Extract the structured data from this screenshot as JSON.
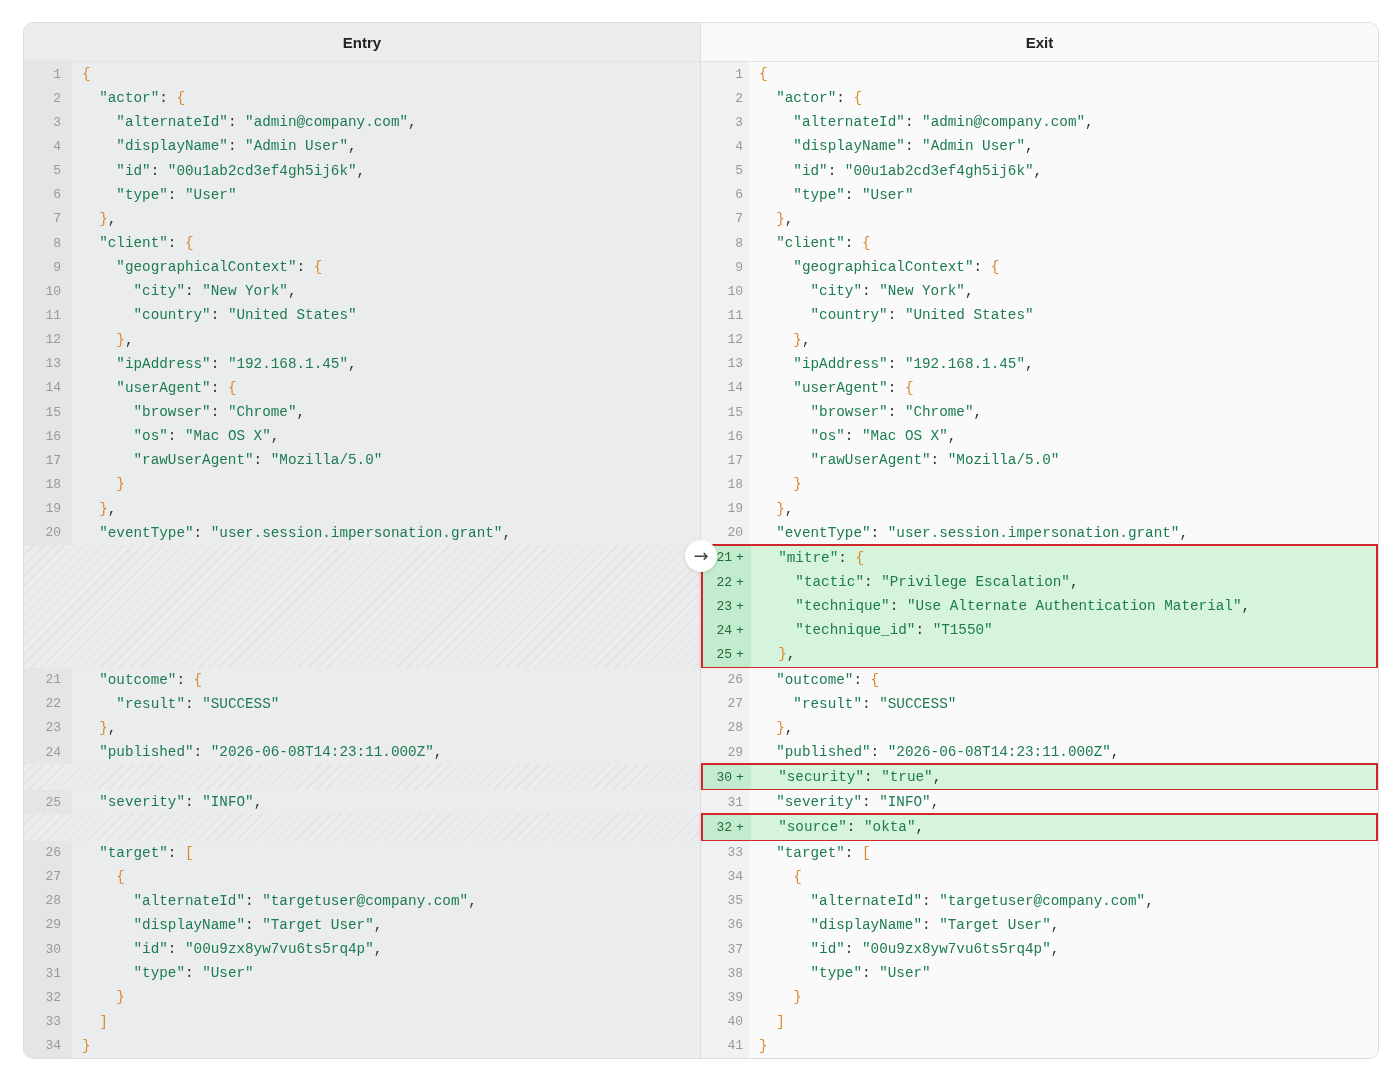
{
  "panes": [
    {
      "title": "Entry"
    },
    {
      "title": "Exit"
    }
  ],
  "blocks": [
    {
      "kind": "same",
      "rows": [
        {
          "left": {
            "number": "1",
            "code": "{"
          },
          "right": {
            "number": "1",
            "code": "{"
          }
        },
        {
          "left": {
            "number": "2",
            "code": "  \"actor\": {"
          },
          "right": {
            "number": "2",
            "code": "  \"actor\": {"
          }
        },
        {
          "left": {
            "number": "3",
            "code": "    \"alternateId\": \"admin@company.com\","
          },
          "right": {
            "number": "3",
            "code": "    \"alternateId\": \"admin@company.com\","
          }
        },
        {
          "left": {
            "number": "4",
            "code": "    \"displayName\": \"Admin User\","
          },
          "right": {
            "number": "4",
            "code": "    \"displayName\": \"Admin User\","
          }
        },
        {
          "left": {
            "number": "5",
            "code": "    \"id\": \"00u1ab2cd3ef4gh5ij6k\","
          },
          "right": {
            "number": "5",
            "code": "    \"id\": \"00u1ab2cd3ef4gh5ij6k\","
          }
        },
        {
          "left": {
            "number": "6",
            "code": "    \"type\": \"User\""
          },
          "right": {
            "number": "6",
            "code": "    \"type\": \"User\""
          }
        },
        {
          "left": {
            "number": "7",
            "code": "  },"
          },
          "right": {
            "number": "7",
            "code": "  },"
          }
        },
        {
          "left": {
            "number": "8",
            "code": "  \"client\": {"
          },
          "right": {
            "number": "8",
            "code": "  \"client\": {"
          }
        },
        {
          "left": {
            "number": "9",
            "code": "    \"geographicalContext\": {"
          },
          "right": {
            "number": "9",
            "code": "    \"geographicalContext\": {"
          }
        },
        {
          "left": {
            "number": "10",
            "code": "      \"city\": \"New York\","
          },
          "right": {
            "number": "10",
            "code": "      \"city\": \"New York\","
          }
        },
        {
          "left": {
            "number": "11",
            "code": "      \"country\": \"United States\""
          },
          "right": {
            "number": "11",
            "code": "      \"country\": \"United States\""
          }
        },
        {
          "left": {
            "number": "12",
            "code": "    },"
          },
          "right": {
            "number": "12",
            "code": "    },"
          }
        },
        {
          "left": {
            "number": "13",
            "code": "    \"ipAddress\": \"192.168.1.45\","
          },
          "right": {
            "number": "13",
            "code": "    \"ipAddress\": \"192.168.1.45\","
          }
        },
        {
          "left": {
            "number": "14",
            "code": "    \"userAgent\": {"
          },
          "right": {
            "number": "14",
            "code": "    \"userAgent\": {"
          }
        },
        {
          "left": {
            "number": "15",
            "code": "      \"browser\": \"Chrome\","
          },
          "right": {
            "number": "15",
            "code": "      \"browser\": \"Chrome\","
          }
        },
        {
          "left": {
            "number": "16",
            "code": "      \"os\": \"Mac OS X\","
          },
          "right": {
            "number": "16",
            "code": "      \"os\": \"Mac OS X\","
          }
        },
        {
          "left": {
            "number": "17",
            "code": "      \"rawUserAgent\": \"Mozilla/5.0\""
          },
          "right": {
            "number": "17",
            "code": "      \"rawUserAgent\": \"Mozilla/5.0\""
          }
        },
        {
          "left": {
            "number": "18",
            "code": "    }"
          },
          "right": {
            "number": "18",
            "code": "    }"
          }
        },
        {
          "left": {
            "number": "19",
            "code": "  },"
          },
          "right": {
            "number": "19",
            "code": "  },"
          }
        },
        {
          "left": {
            "number": "20",
            "code": "  \"eventType\": \"user.session.impersonation.grant\","
          },
          "right": {
            "number": "20",
            "code": "  \"eventType\": \"user.session.impersonation.grant\","
          }
        }
      ]
    },
    {
      "kind": "added",
      "action": "→",
      "lines": [
        {
          "number": "21",
          "marker": "+",
          "code": "  \"mitre\": {"
        },
        {
          "number": "22",
          "marker": "+",
          "code": "    \"tactic\": \"Privilege Escalation\","
        },
        {
          "number": "23",
          "marker": "+",
          "code": "    \"technique\": \"Use Alternate Authentication Material\","
        },
        {
          "number": "24",
          "marker": "+",
          "code": "    \"technique_id\": \"T1550\""
        },
        {
          "number": "25",
          "marker": "+",
          "code": "  },"
        }
      ]
    },
    {
      "kind": "same",
      "rows": [
        {
          "left": {
            "number": "21",
            "code": "  \"outcome\": {"
          },
          "right": {
            "number": "26",
            "code": "  \"outcome\": {"
          }
        },
        {
          "left": {
            "number": "22",
            "code": "    \"result\": \"SUCCESS\""
          },
          "right": {
            "number": "27",
            "code": "    \"result\": \"SUCCESS\""
          }
        },
        {
          "left": {
            "number": "23",
            "code": "  },"
          },
          "right": {
            "number": "28",
            "code": "  },"
          }
        },
        {
          "left": {
            "number": "24",
            "code": "  \"published\": \"2026-06-08T14:23:11.000Z\","
          },
          "right": {
            "number": "29",
            "code": "  \"published\": \"2026-06-08T14:23:11.000Z\","
          }
        }
      ]
    },
    {
      "kind": "added",
      "lines": [
        {
          "number": "30",
          "marker": "+",
          "code": "  \"security\": \"true\","
        }
      ]
    },
    {
      "kind": "same",
      "rows": [
        {
          "left": {
            "number": "25",
            "code": "  \"severity\": \"INFO\","
          },
          "right": {
            "number": "31",
            "code": "  \"severity\": \"INFO\","
          }
        }
      ]
    },
    {
      "kind": "added",
      "lines": [
        {
          "number": "32",
          "marker": "+",
          "code": "  \"source\": \"okta\","
        }
      ]
    },
    {
      "kind": "same",
      "rows": [
        {
          "left": {
            "number": "26",
            "code": "  \"target\": ["
          },
          "right": {
            "number": "33",
            "code": "  \"target\": ["
          }
        },
        {
          "left": {
            "number": "27",
            "code": "    {"
          },
          "right": {
            "number": "34",
            "code": "    {"
          }
        },
        {
          "left": {
            "number": "28",
            "code": "      \"alternateId\": \"targetuser@company.com\","
          },
          "right": {
            "number": "35",
            "code": "      \"alternateId\": \"targetuser@company.com\","
          }
        },
        {
          "left": {
            "number": "29",
            "code": "      \"displayName\": \"Target User\","
          },
          "right": {
            "number": "36",
            "code": "      \"displayName\": \"Target User\","
          }
        },
        {
          "left": {
            "number": "30",
            "code": "      \"id\": \"00u9zx8yw7vu6ts5rq4p\","
          },
          "right": {
            "number": "37",
            "code": "      \"id\": \"00u9zx8yw7vu6ts5rq4p\","
          }
        },
        {
          "left": {
            "number": "31",
            "code": "      \"type\": \"User\""
          },
          "right": {
            "number": "38",
            "code": "      \"type\": \"User\""
          }
        },
        {
          "left": {
            "number": "32",
            "code": "    }"
          },
          "right": {
            "number": "39",
            "code": "    }"
          }
        },
        {
          "left": {
            "number": "33",
            "code": "  ]"
          },
          "right": {
            "number": "40",
            "code": "  ]"
          }
        },
        {
          "left": {
            "number": "34",
            "code": "}"
          },
          "right": {
            "number": "41",
            "code": "}"
          }
        }
      ]
    }
  ]
}
